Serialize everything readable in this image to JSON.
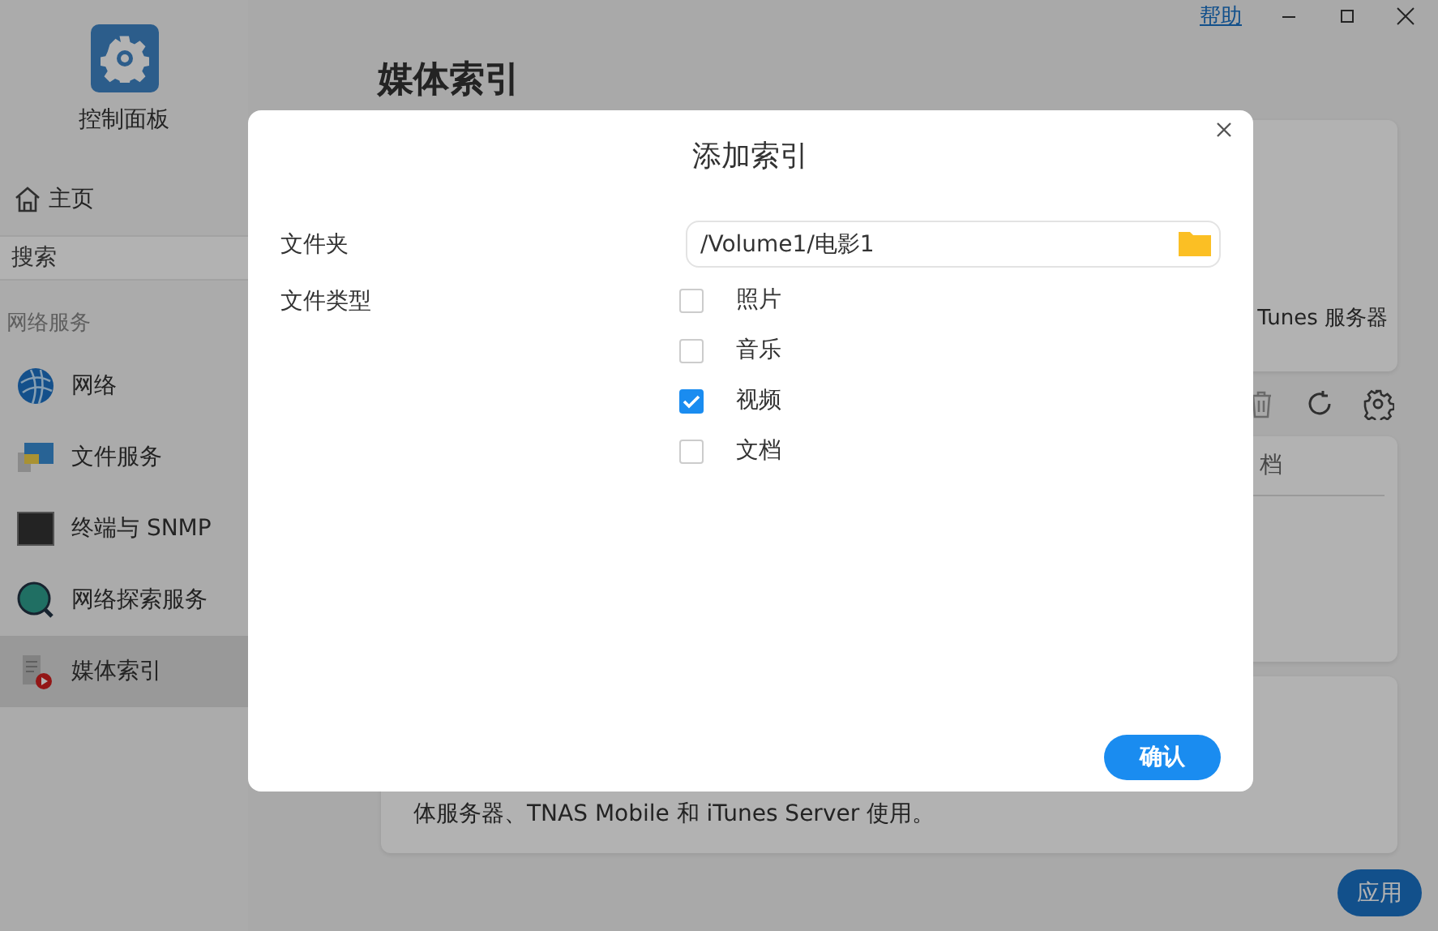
{
  "window": {
    "help_link": "帮助"
  },
  "sidebar": {
    "app_title": "控制面板",
    "home": "主页",
    "search": {
      "placeholder": "搜索"
    },
    "section": "网络服务",
    "items": [
      {
        "label": "网络",
        "selected": false
      },
      {
        "label": "文件服务",
        "selected": false
      },
      {
        "label": "终端与 SNMP",
        "selected": false
      },
      {
        "label": "网络探索服务",
        "selected": false
      },
      {
        "label": "媒体索引",
        "selected": true
      }
    ]
  },
  "main": {
    "title": "媒体索引",
    "card_text": "Tunes 服务器",
    "list_header": "档",
    "description": "体服务器、TNAS Mobile 和 iTunes Server 使用。",
    "apply": "应用"
  },
  "dialog": {
    "title": "添加索引",
    "folder_label": "文件夹",
    "folder_value": "/Volume1/电影1",
    "types_label": "文件类型",
    "types": [
      {
        "label": "照片",
        "checked": false
      },
      {
        "label": "音乐",
        "checked": false
      },
      {
        "label": "视频",
        "checked": true
      },
      {
        "label": "文档",
        "checked": false
      }
    ],
    "confirm": "确认"
  }
}
